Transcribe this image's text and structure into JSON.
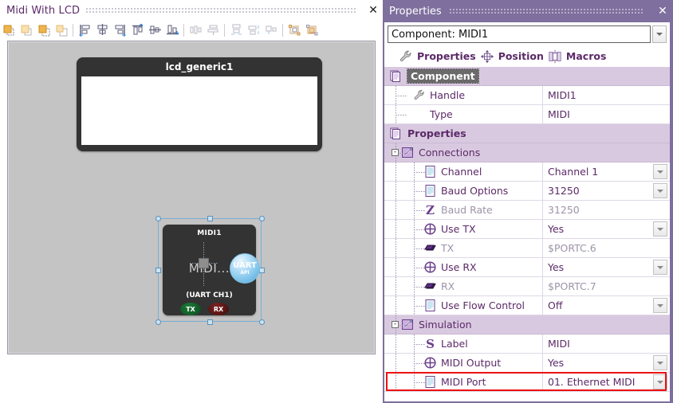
{
  "left_panel": {
    "title": "Midi With LCD",
    "close_icon": "close-icon",
    "toolbar": [
      {
        "name": "bring-to-front-icon"
      },
      {
        "name": "bring-forward-icon"
      },
      {
        "name": "send-backward-icon"
      },
      {
        "name": "send-to-back-icon"
      },
      {
        "name": "align-left-icon"
      },
      {
        "name": "align-center-horizontal-icon"
      },
      {
        "name": "align-right-icon"
      },
      {
        "name": "align-top-icon"
      },
      {
        "name": "align-middle-vertical-icon"
      },
      {
        "name": "align-bottom-icon"
      },
      {
        "name": "distribute-horizontal-icon"
      },
      {
        "name": "distribute-vertical-icon"
      },
      {
        "name": "space-horizontal-icon"
      },
      {
        "name": "space-vertical-icon"
      },
      {
        "name": "make-same-size-icon"
      },
      {
        "name": "size-to-grid-icon"
      },
      {
        "name": "group-icon"
      }
    ],
    "canvas": {
      "lcd": {
        "title": "lcd_generic1"
      },
      "midi": {
        "name": "MIDI1",
        "big_label": "MIDI...",
        "channel_label": "(UART CH1)",
        "tx_pin": "TX",
        "rx_pin": "RX",
        "badge_line1": "UART",
        "badge_line2": "API"
      }
    }
  },
  "right_panel": {
    "title": "Properties",
    "close_icon": "close-icon",
    "component_combo": {
      "value": "Component: MIDI1",
      "placeholder": "Component: MIDI1"
    },
    "tabs": [
      {
        "label": "Properties",
        "icon": "wrench-icon"
      },
      {
        "label": "Position",
        "icon": "move-arrows-icon"
      },
      {
        "label": "Macros",
        "icon": "macros-icon"
      }
    ],
    "rows": [
      {
        "kind": "group",
        "indent": 0,
        "icon": "pages-icon",
        "name": "Component",
        "value": "",
        "selected": true
      },
      {
        "kind": "item",
        "indent": 2,
        "icon": "wrench-icon",
        "name": "Handle",
        "value": "MIDI1",
        "dropdown": false
      },
      {
        "kind": "item",
        "indent": 2,
        "icon": "none",
        "name": "Type",
        "value": "MIDI",
        "dropdown": false
      },
      {
        "kind": "group",
        "indent": 0,
        "icon": "pages-icon",
        "name": "Properties",
        "value": "",
        "bold": true
      },
      {
        "kind": "sub",
        "indent": 1,
        "icon": "folder-pencil-icon",
        "name": "Connections",
        "value": "",
        "expander": "-"
      },
      {
        "kind": "item",
        "indent": 3,
        "icon": "list-icon",
        "name": "Channel",
        "value": "Channel 1",
        "dropdown": true
      },
      {
        "kind": "item",
        "indent": 3,
        "icon": "list-icon",
        "name": "Baud Options",
        "value": "31250",
        "dropdown": true
      },
      {
        "kind": "item",
        "indent": 3,
        "icon": "z-icon",
        "name": "Baud Rate",
        "value": "31250",
        "dropdown": false,
        "dim": true
      },
      {
        "kind": "item",
        "indent": 3,
        "icon": "circle-plus-icon",
        "name": "Use TX",
        "value": "Yes",
        "dropdown": true
      },
      {
        "kind": "item",
        "indent": 3,
        "icon": "pin-icon",
        "name": "TX",
        "value": "$PORTC.6",
        "dropdown": false,
        "dim": true
      },
      {
        "kind": "item",
        "indent": 3,
        "icon": "circle-plus-icon",
        "name": "Use RX",
        "value": "Yes",
        "dropdown": true
      },
      {
        "kind": "item",
        "indent": 3,
        "icon": "pin-icon",
        "name": "RX",
        "value": "$PORTC.7",
        "dropdown": false,
        "dim": true
      },
      {
        "kind": "item",
        "indent": 3,
        "icon": "list-icon",
        "name": "Use Flow Control",
        "value": "Off",
        "dropdown": true
      },
      {
        "kind": "sub",
        "indent": 1,
        "icon": "folder-pencil-icon",
        "name": "Simulation",
        "value": "",
        "expander": "-"
      },
      {
        "kind": "item",
        "indent": 3,
        "icon": "s-icon",
        "name": "Label",
        "value": "MIDI",
        "dropdown": false
      },
      {
        "kind": "item",
        "indent": 3,
        "icon": "circle-plus-icon",
        "name": "MIDI Output",
        "value": "Yes",
        "dropdown": true
      },
      {
        "kind": "item",
        "indent": 3,
        "icon": "list-icon",
        "name": "MIDI Port",
        "value": "01. Ethernet MIDI",
        "dropdown": true,
        "highlight": true
      }
    ]
  },
  "colors": {
    "panel_purple": "#7e6f9e",
    "group_row": "#d9c9e0",
    "text_purple": "#5c2a68",
    "highlight_red": "#ee1111",
    "canvas_gray": "#c4c4c4",
    "component_dark": "#333333"
  }
}
